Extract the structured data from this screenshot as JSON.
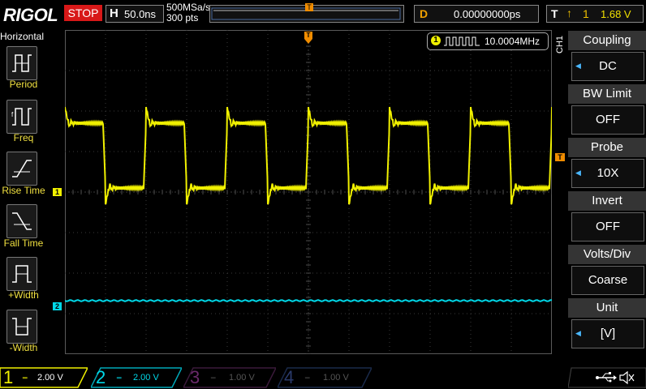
{
  "topbar": {
    "brand": "RIGOL",
    "run_state": "STOP",
    "horiz_label": "H",
    "timebase": "50.0ns",
    "sample_rate": "500MSa/s",
    "memory_depth": "300  pts",
    "trig_pos_marker": "T",
    "delay_label": "D",
    "delay_value": "0.00000000ps",
    "trig_label": "T",
    "trig_edge": "↑",
    "trig_source_num": "1",
    "trig_level": "1.68 V"
  },
  "left_menu": {
    "title": "Horizontal",
    "items": [
      {
        "label": "Period",
        "icon": "period-icon"
      },
      {
        "label": "Freq",
        "icon": "freq-icon"
      },
      {
        "label": "Rise Time",
        "icon": "rise-time-icon"
      },
      {
        "label": "Fall Time",
        "icon": "fall-time-icon"
      },
      {
        "label": "+Width",
        "icon": "positive-width-icon"
      },
      {
        "label": "-Width",
        "icon": "negative-width-icon"
      }
    ]
  },
  "measurement": {
    "channel": "1",
    "value": "10.0004MHz"
  },
  "right_menu": {
    "channel_label": "CH1",
    "items": [
      {
        "title": "Coupling",
        "value": "DC",
        "has_arrow": true
      },
      {
        "title": "BW Limit",
        "value": "OFF",
        "has_arrow": false
      },
      {
        "title": "Probe",
        "value": "10X",
        "has_arrow": true
      },
      {
        "title": "Invert",
        "value": "OFF",
        "has_arrow": false
      },
      {
        "title": "Volts/Div",
        "value": "Coarse",
        "has_arrow": false
      },
      {
        "title": "Unit",
        "value": "[V]",
        "has_arrow": true
      }
    ]
  },
  "markers": {
    "ch1_ground": "1",
    "ch2_ground": "2",
    "trigger_level": "T",
    "trigger_top": "T"
  },
  "channels": [
    {
      "num": "1",
      "scale": "2.00 V",
      "color": "#f0f000",
      "active": true
    },
    {
      "num": "2",
      "scale": "2.00 V",
      "color": "#00d8e8",
      "active": false
    },
    {
      "num": "3",
      "scale": "1.00 V",
      "color": "#c000c0",
      "active": false
    },
    {
      "num": "4",
      "scale": "1.00 V",
      "color": "#2060ff",
      "active": false
    }
  ],
  "colors": {
    "ch1": "#f0f000",
    "ch2": "#00d8e8",
    "trigger": "#f08c00",
    "stop": "#d81818",
    "accent_blue": "#4ab8ff"
  },
  "status_icons": [
    "usb-icon",
    "speaker-mute-icon"
  ]
}
